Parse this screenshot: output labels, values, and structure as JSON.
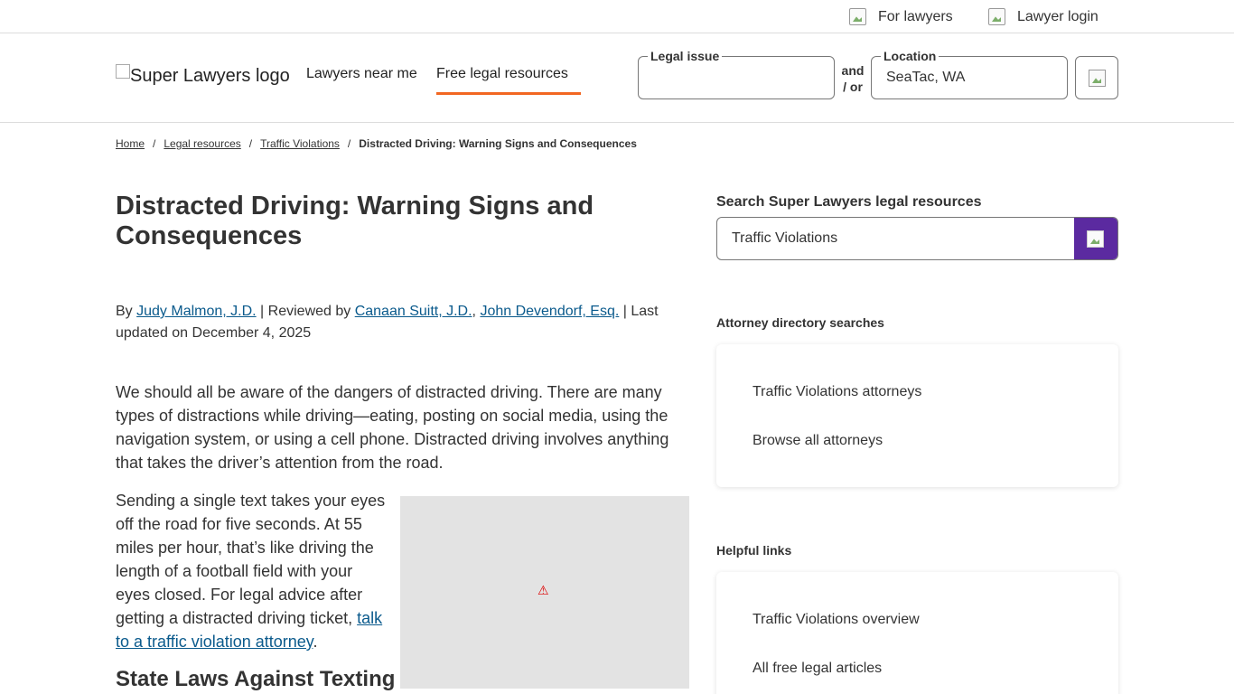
{
  "utility": {
    "for_lawyers": "For lawyers",
    "lawyer_login": "Lawyer login"
  },
  "header": {
    "logo_alt": "Super Lawyers logo",
    "nav": {
      "lawyers_near_me": "Lawyers near me",
      "free_legal_resources": "Free legal resources"
    },
    "legal_issue_label": "Legal issue",
    "legal_issue_value": "",
    "and_or": "and / or",
    "location_label": "Location",
    "location_value": "SeaTac, WA",
    "accent_color": "#f26722"
  },
  "breadcrumb": {
    "home": "Home",
    "legal_resources": "Legal resources",
    "traffic_violations": "Traffic Violations",
    "current": "Distracted Driving: Warning Signs and Consequences",
    "separator": "/"
  },
  "article": {
    "title": "Distracted Driving: Warning Signs and Consequences",
    "byline": {
      "by": "By ",
      "author": "Judy Malmon, J.D.",
      "reviewed_by": " | Reviewed by ",
      "reviewer1": "Canaan Suitt, J.D.",
      "comma": ", ",
      "reviewer2": "John Devendorf, Esq.",
      "updated": " | Last updated on December 4, 2025"
    },
    "para1": "We should all be aware of the dangers of distracted driving. There are many types of distractions while driving—eating, posting on social media, using the navigation system, or using a cell phone. Distracted driving involves anything that takes the driver’s attention from the road.",
    "para2_text": "Sending a single text takes your eyes off the road for five seconds. At 55 miles per hour, that’s like driving the length of a football field with your eyes closed. For legal advice after getting a distracted driving ticket, ",
    "para2_link": "talk to a traffic violation attorney",
    "para2_end": ".",
    "image_warning": "⚠",
    "section_heading": "State Laws Against Texting"
  },
  "sidebar": {
    "search_label": "Search Super Lawyers legal resources",
    "search_value": "Traffic Violations",
    "search_button_color": "#5b2aa0",
    "attorney_heading": "Attorney directory searches",
    "attorney_links": [
      "Traffic Violations attorneys",
      "Browse all attorneys"
    ],
    "helpful_heading": "Helpful links",
    "helpful_links": [
      "Traffic Violations overview",
      "All free legal articles"
    ]
  }
}
